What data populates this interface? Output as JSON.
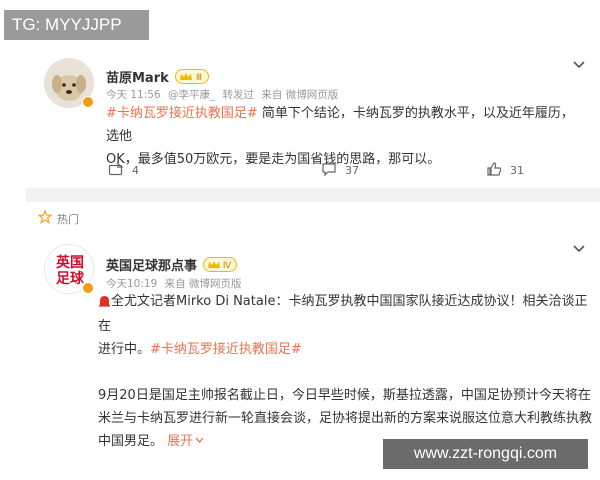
{
  "watermark_top": "TG: MYYJJPP",
  "watermark_bottom": "www.zzt-rongqi.com",
  "post1": {
    "author": "苗原Mark",
    "vip_level": "Ⅲ",
    "time": "今天 11:56",
    "via_user": "@李平康_",
    "via_suffix": "转发过",
    "source": "来自 微博网页版",
    "hashtag": "#卡纳瓦罗接近执教国足#",
    "text_line1": " 简单下个结论，卡纳瓦罗的执教水平，以及近年履历，选他",
    "text_line2": "OK，最多值50万欧元，要是走为国省钱的思路，那可以。",
    "reposts": "4",
    "comments": "37",
    "likes": "31"
  },
  "post2": {
    "section_label": "热门",
    "author": "英国足球那点事",
    "vip_level": "Ⅳ",
    "time": "今天10:19",
    "source": "来自 微博网页版",
    "avatar_text_top": "英国",
    "avatar_text_bottom": "足球",
    "p1_prefix": "全尤文记者Mirko Di Natale：卡纳瓦罗执教中国国家队接近达成协议！相关洽谈正在",
    "p1_line2": "进行中。",
    "hashtag": "#卡纳瓦罗接近执教国足#",
    "p2_line1": "9月20日是国足主帅报名截止日，今日早些时候，斯基拉透露，中国足协预计今天将在",
    "p2_line2": "米兰与卡纳瓦罗进行新一轮直接会谈，足协将提出新的方案来说服这位意大利教练执教",
    "p2_line3": "中国男足。",
    "expand_label": "展开"
  },
  "colors": {
    "accent": "#eb7350",
    "vip_gold": "#f5b800",
    "muted": "#999999",
    "separator": "#f2f2f2"
  },
  "icons": [
    "chevron-down-icon",
    "repost-icon",
    "comment-icon",
    "like-icon",
    "hot-icon",
    "alarm-icon",
    "vip-crown-icon",
    "verified-badge-icon"
  ]
}
